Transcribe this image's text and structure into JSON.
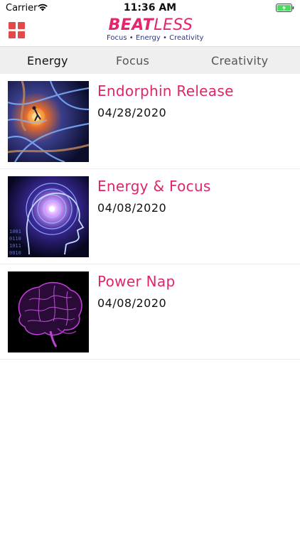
{
  "status_bar": {
    "carrier": "Carrier",
    "time": "11:36 AM"
  },
  "header": {
    "logo_beat": "BEAT",
    "logo_less": "LESS",
    "tagline": "Focus • Energy • Creativity",
    "menu_icon": "grid-icon"
  },
  "tabs": [
    {
      "label": "Energy",
      "selected": true
    },
    {
      "label": "Focus",
      "selected": false
    },
    {
      "label": "Creativity",
      "selected": false
    }
  ],
  "items": [
    {
      "title": "Endorphin Release",
      "date": "04/28/2020",
      "thumbnail": "neuron-runner-image"
    },
    {
      "title": "Energy & Focus",
      "date": "04/08/2020",
      "thumbnail": "digital-head-image"
    },
    {
      "title": "Power Nap",
      "date": "04/08/2020",
      "thumbnail": "purple-brain-image"
    }
  ],
  "colors": {
    "accent": "#e0246c",
    "tagline": "#2c3a86",
    "menu_icon": "#e24a4a",
    "tab_bar_bg": "#efefef"
  }
}
